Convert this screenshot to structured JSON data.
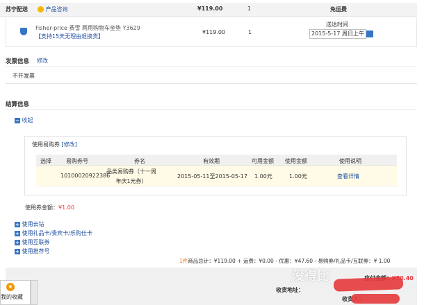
{
  "shipping": {
    "vendor": "苏宁配送",
    "consult": "产品咨询",
    "price": "¥119.00",
    "qty": "1",
    "freight": "免运费"
  },
  "item": {
    "name": "Fisher-price 费雪 两用购物车坐垫 Y3629",
    "return_policy": "【支持15天无理由退换货】",
    "price": "¥119.00",
    "qty": "1",
    "delivery_label": "送达时间",
    "delivery_value": "2015-5-17 周日上午"
  },
  "invoice": {
    "title": "发票信息",
    "edit": "修改",
    "value": "不开发票"
  },
  "settlement": {
    "title": "结算信息",
    "collapse": "收起",
    "coupon_label": "使用易购券",
    "coupon_edit": "[修改]",
    "headers": [
      "选择",
      "易购券号",
      "券名",
      "有效期",
      "可用金额",
      "使用金额",
      "使用说明"
    ],
    "coupon": {
      "number": "10100020922386",
      "name_line1": "品类易购券（十一周",
      "name_line2": "年庆1元券）",
      "validity": "2015-05-11至2015-05-17",
      "available": "1.00元",
      "used": "1.00元",
      "details": "查看详情"
    },
    "coupon_amount_label": "使用券金额：",
    "coupon_amount_value": "¥1.00",
    "options": [
      "使用云钻",
      "使用礼品卡/贵宾卡/乐购仕卡",
      "使用互联券",
      "使用推荐号"
    ]
  },
  "summary": {
    "count": "1件",
    "text": "商品总计：¥119.00 + 运费：¥0.00 - 优惠：¥47.60 - 易购券/礼品卡/互联券：¥ 1.00"
  },
  "footer": {
    "payable_label": "应付金额：",
    "payable_value": "¥70.40",
    "address_label": "收货地址：",
    "receiver_label": "收货人：",
    "favorites": "我的收藏"
  },
  "watermark": "没得比",
  "colors": {
    "link": "#1f4f9f",
    "price_red": "#e4393c",
    "discount_orange": "#ff6600",
    "checkbox_blue": "#3675c5"
  }
}
